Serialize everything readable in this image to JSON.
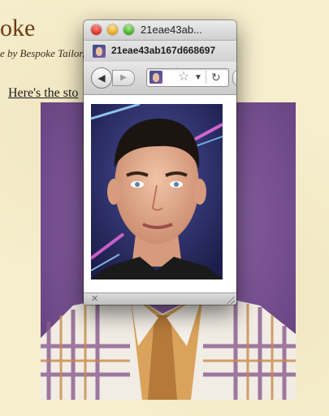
{
  "page": {
    "site_title": "oke",
    "tagline": "e by Bespoke Tailor,",
    "story_link": "Here's the sto"
  },
  "popup": {
    "window_title": "21eae43ab...",
    "tab_label": "21eae43ab167d668697",
    "back_icon": "back-arrow-icon",
    "forward_icon": "forward-arrow-icon",
    "bookmark_icon": "star-icon",
    "reload_icon": "reload-icon"
  },
  "colors": {
    "page_background": "#f6eecd",
    "title_color": "#6e3b17",
    "purple_backdrop": "#7a5394"
  }
}
